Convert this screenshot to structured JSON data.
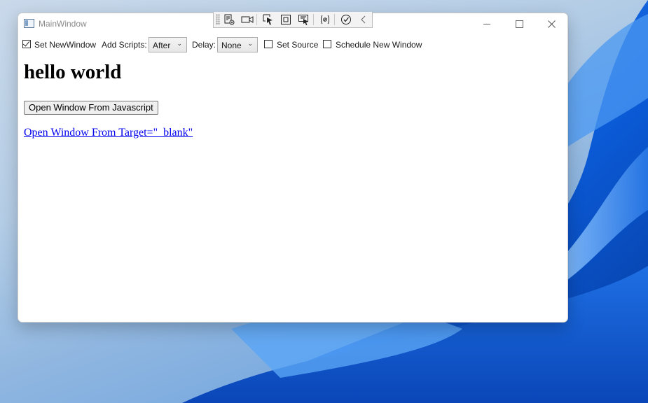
{
  "window": {
    "title": "MainWindow"
  },
  "toolbar": {
    "set_new_window": {
      "label": "Set NewWindow",
      "checked": true
    },
    "add_scripts": {
      "label": "Add Scripts:",
      "value": "After"
    },
    "delay": {
      "label": "Delay:",
      "value": "None"
    },
    "set_source": {
      "label": "Set Source",
      "checked": false
    },
    "schedule_new_window": {
      "label": "Schedule New Window",
      "checked": false
    }
  },
  "page": {
    "heading": "hello world",
    "open_js_button": "Open Window From Javascript",
    "open_target_link": "Open Window From Target=\"_blank\""
  },
  "devtools_icons": [
    "grip-icon",
    "live-tree-icon",
    "record-icon",
    "select-element-icon",
    "display-layout-icon",
    "track-focus-icon",
    "binding-failures-icon",
    "hot-reload-check-icon",
    "collapse-chevron-icon"
  ],
  "colors": {
    "link": "#0000ee",
    "wallpaper_accent": "#1a6fe0"
  }
}
